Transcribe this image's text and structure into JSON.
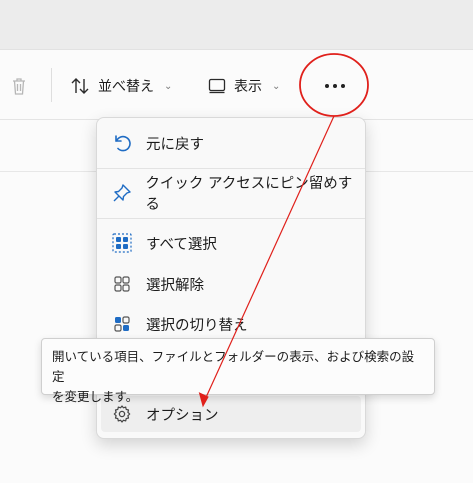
{
  "toolbar": {
    "delete_icon": "trash-icon",
    "sort_label": "並べ替え",
    "sort_icon": "sort-arrows-icon",
    "view_label": "表示",
    "view_icon": "view-pane-icon",
    "more_icon": "more-dots-icon"
  },
  "menu": {
    "items": [
      {
        "label": "元に戻す",
        "icon": "undo-icon"
      },
      {
        "label": "クイック アクセスにピン留めする",
        "icon": "pin-icon"
      },
      {
        "label": "すべて選択",
        "icon": "select-all-icon"
      },
      {
        "label": "選択解除",
        "icon": "select-none-icon"
      },
      {
        "label": "選択の切り替え",
        "icon": "invert-selection-icon"
      },
      {
        "label": "オプション",
        "icon": "gear-icon"
      }
    ]
  },
  "tooltip": {
    "line1": "開いている項目、ファイルとフォルダーの表示、および検索の設定",
    "line2": "を変更します。"
  },
  "annotation": {
    "color": "#e0201b"
  }
}
